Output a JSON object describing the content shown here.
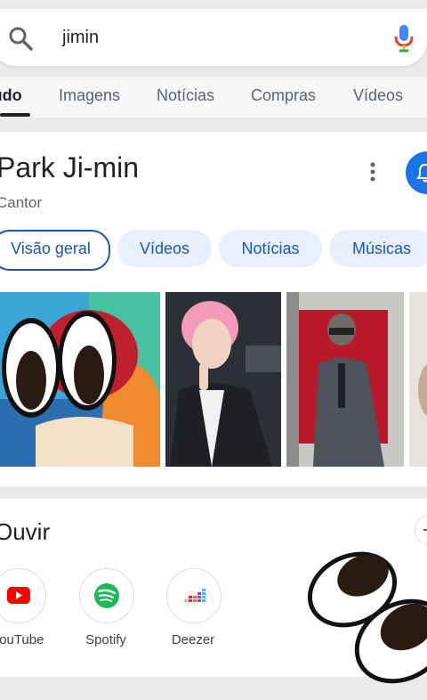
{
  "search": {
    "query": "jimin"
  },
  "tabs": [
    {
      "label": "Tudo",
      "active": true
    },
    {
      "label": "Imagens"
    },
    {
      "label": "Notícias"
    },
    {
      "label": "Compras"
    },
    {
      "label": "Vídeos"
    }
  ],
  "knowledge_panel": {
    "title": "Park Ji-min",
    "subtitle": "Cantor",
    "chips": [
      {
        "label": "Visão geral",
        "active": true
      },
      {
        "label": "Vídeos"
      },
      {
        "label": "Notícias"
      },
      {
        "label": "Músicas"
      }
    ]
  },
  "listen": {
    "title": "Ouvir",
    "apps": [
      {
        "label": "YouTube",
        "icon": "youtube-icon",
        "color": "#ff0000"
      },
      {
        "label": "Spotify",
        "icon": "spotify-icon",
        "color": "#1db954"
      },
      {
        "label": "Deezer",
        "icon": "deezer-icon",
        "color": "#a238ff"
      }
    ]
  },
  "colors": {
    "accent": "#1a73e8",
    "chip_bg": "#e8f0fe",
    "chip_text": "#1a56b7"
  }
}
